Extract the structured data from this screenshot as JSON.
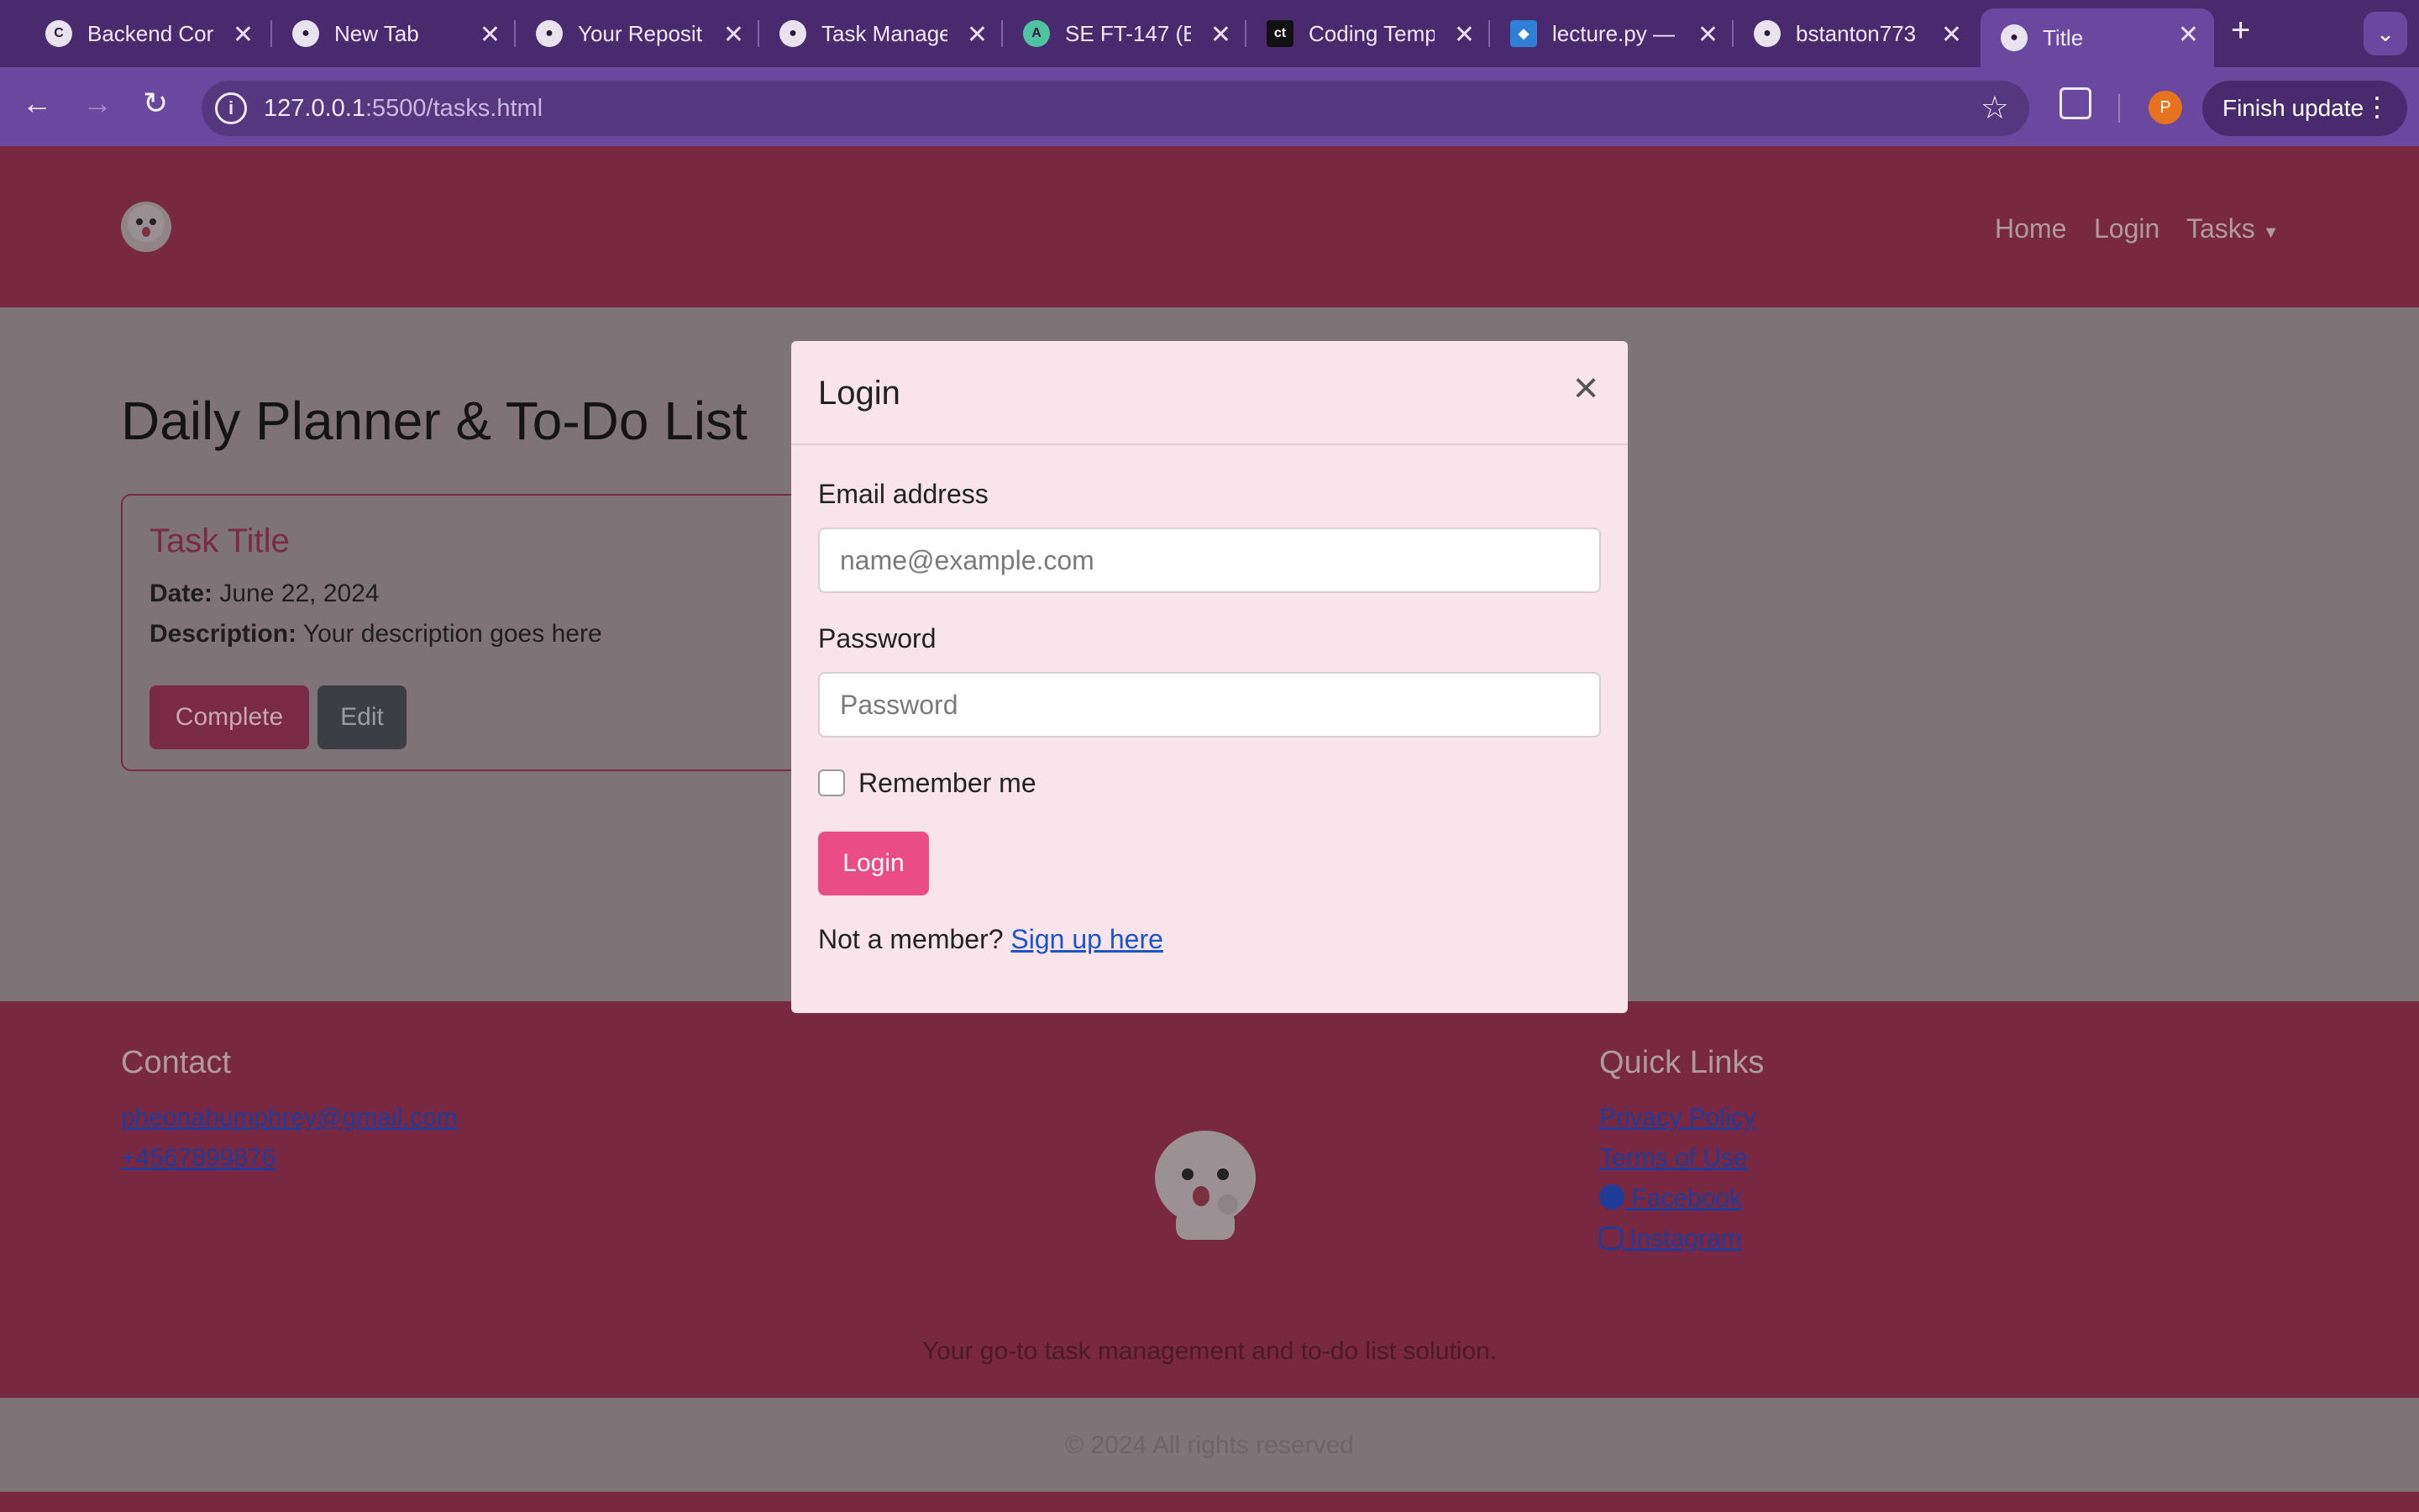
{
  "browser": {
    "tabs": [
      {
        "title": "Backend Cor",
        "favicon": "C"
      },
      {
        "title": "New Tab",
        "favicon": "●"
      },
      {
        "title": "Your Reposit",
        "favicon": "●"
      },
      {
        "title": "Task Manage",
        "favicon": "●"
      },
      {
        "title": "SE FT-147 (B",
        "favicon": "A"
      },
      {
        "title": "Coding Temp",
        "favicon": "ct"
      },
      {
        "title": "lecture.py —",
        "favicon": "◆"
      },
      {
        "title": "bstanton773",
        "favicon": "●"
      },
      {
        "title": "Title",
        "favicon": "●"
      }
    ],
    "url_host": "127.0.0.1",
    "url_path": ":5500/tasks.html",
    "profile_initial": "P",
    "finish_update_label": "Finish update"
  },
  "header": {
    "nav": [
      "Home",
      "Login",
      "Tasks"
    ]
  },
  "main": {
    "title": "Daily Planner & To-Do List",
    "card": {
      "title": "Task Title",
      "date_label": "Date:",
      "date_value": "June 22, 2024",
      "desc_label": "Description:",
      "desc_value": "Your description goes here",
      "complete_label": "Complete",
      "edit_label": "Edit"
    }
  },
  "footer": {
    "contact_heading": "Contact",
    "email": "pheonahumphrey@gmail.com",
    "phone": "+4567899876",
    "links_heading": "Quick Links",
    "links": [
      "Privacy Policy",
      "Terms of Use",
      "Facebook",
      "Instagram"
    ],
    "tagline": "Your go-to task management and to-do list solution.",
    "copyright": "© 2024 All rights reserved"
  },
  "modal": {
    "title": "Login",
    "email_label": "Email address",
    "email_placeholder": "name@example.com",
    "password_label": "Password",
    "password_placeholder": "Password",
    "remember_label": "Remember me",
    "login_button": "Login",
    "signup_prefix": "Not a member?",
    "signup_link": "Sign up here"
  }
}
